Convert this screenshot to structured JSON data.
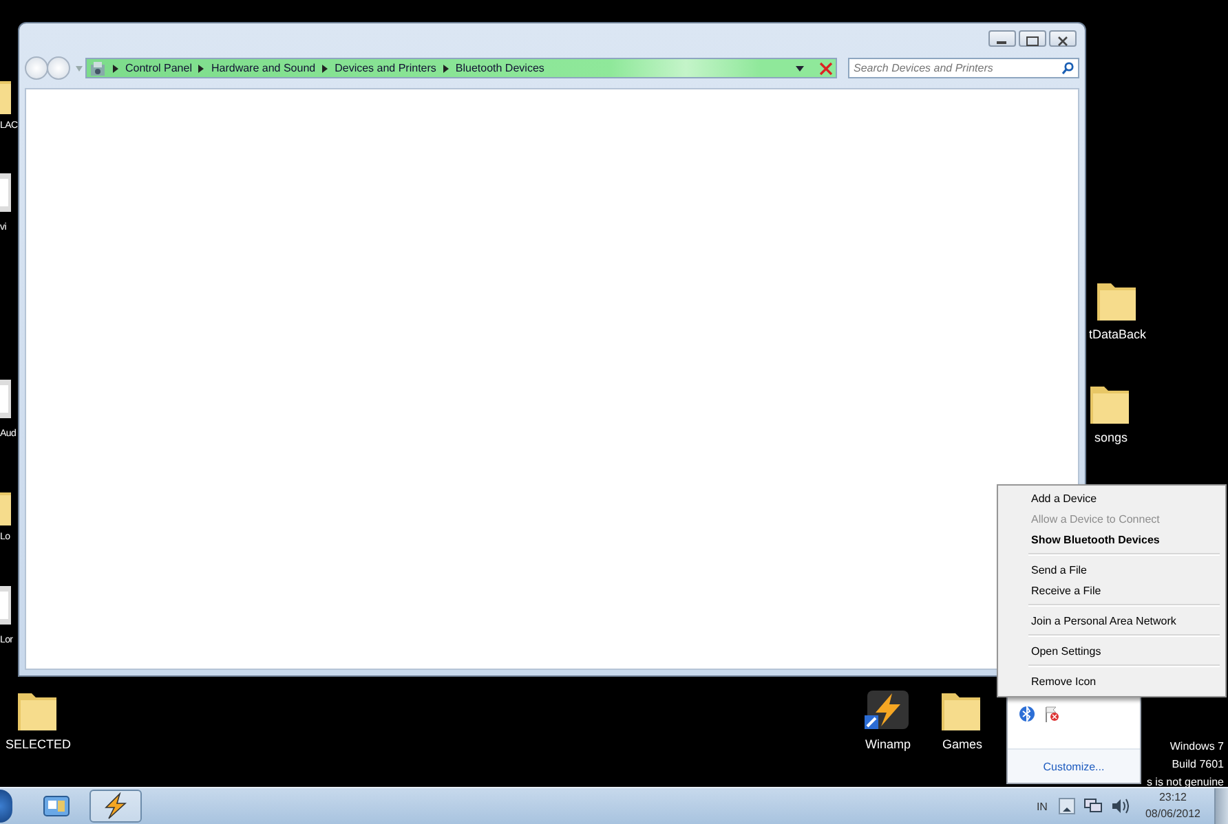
{
  "desktop_icons": [
    {
      "label": "LAC",
      "kind": "folder"
    },
    {
      "label": "vi",
      "kind": "file"
    },
    {
      "label": "Aud",
      "kind": "file"
    },
    {
      "label": "Lo",
      "kind": "folder"
    },
    {
      "label": "Lor",
      "kind": "file"
    },
    {
      "label": "tDataBack",
      "kind": "folder"
    },
    {
      "label": "songs",
      "kind": "folder"
    },
    {
      "label": "SELECTED",
      "kind": "folder"
    },
    {
      "label": "Winamp",
      "kind": "app"
    },
    {
      "label": "Games",
      "kind": "folder"
    }
  ],
  "explorer_window": {
    "breadcrumb": [
      "Control Panel",
      "Hardware and Sound",
      "Devices and Printers",
      "Bluetooth Devices"
    ],
    "search": {
      "placeholder": "Search Devices and Printers"
    }
  },
  "context_menu": [
    {
      "kind": "item",
      "label": "Add a Device",
      "disabled": false,
      "bold": false
    },
    {
      "kind": "item",
      "label": "Allow a Device to Connect",
      "disabled": true,
      "bold": false
    },
    {
      "kind": "item",
      "label": "Show Bluetooth Devices",
      "disabled": false,
      "bold": true
    },
    {
      "kind": "separator"
    },
    {
      "kind": "item",
      "label": "Send a File",
      "disabled": false,
      "bold": false
    },
    {
      "kind": "item",
      "label": "Receive a File",
      "disabled": false,
      "bold": false
    },
    {
      "kind": "separator"
    },
    {
      "kind": "item",
      "label": "Join a Personal Area Network",
      "disabled": false,
      "bold": false
    },
    {
      "kind": "separator"
    },
    {
      "kind": "item",
      "label": "Open Settings",
      "disabled": false,
      "bold": false
    },
    {
      "kind": "separator"
    },
    {
      "kind": "item",
      "label": "Remove Icon",
      "disabled": false,
      "bold": false
    }
  ],
  "tray_overflow": {
    "link": "Customize..."
  },
  "genuine_notice": [
    "Windows 7",
    "Build 7601",
    "s is not genuine"
  ],
  "taskbar": {
    "language": "IN",
    "time": "23:12",
    "date": "08/06/2012"
  }
}
